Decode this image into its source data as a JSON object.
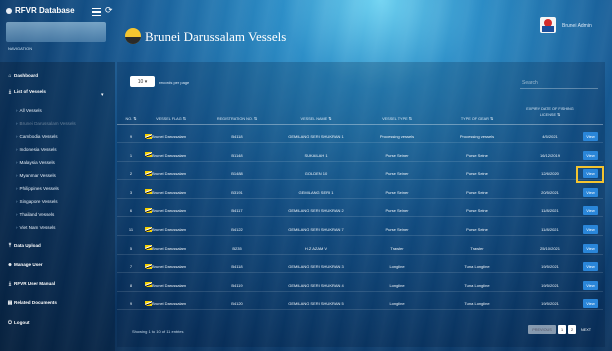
{
  "app": {
    "brand": "RFVR Database",
    "page_title": "Brunei Darussalam Vessels",
    "username": "Brunei Admin"
  },
  "sidebar": {
    "section_label": "NAVIGATION",
    "items": [
      {
        "label": "Dashboard",
        "icon": "home-icon"
      },
      {
        "label": "List of Vessels",
        "icon": "download-icon"
      },
      {
        "label": "All Vessels"
      },
      {
        "label": "Brunei Darussalam Vessels"
      },
      {
        "label": "Cambodia Vessels"
      },
      {
        "label": "Indonesia Vessels"
      },
      {
        "label": "Malaysia Vessels"
      },
      {
        "label": "Myanmar Vessels"
      },
      {
        "label": "Philippines Vessels"
      },
      {
        "label": "Singapore Vessels"
      },
      {
        "label": "Thailand Vessels"
      },
      {
        "label": "Viet Nam Vessels"
      },
      {
        "label": "Data Upload",
        "icon": "upload-icon"
      },
      {
        "label": "Manage User",
        "icon": "users-icon"
      },
      {
        "label": "RFVR User Manual",
        "icon": "download-icon"
      },
      {
        "label": "Related Documents",
        "icon": "document-icon"
      },
      {
        "label": "Logout",
        "icon": "power-icon"
      }
    ]
  },
  "table_controls": {
    "length_value": "10",
    "length_label": "records per page",
    "search_placeholder": "Search"
  },
  "table": {
    "headers": [
      "NO.",
      "VESSEL FLAG",
      "REGISTRATION NO.",
      "VESSEL NAME",
      "VESSEL TYPE",
      "TYPE OF GEAR",
      "EXPIRY DATE OF FISHING LICENSE",
      ""
    ],
    "rows": [
      [
        "9",
        "Brunei Darussalam",
        "B4118",
        "GEMILANG SERI SHUKRAN 1",
        "Processing vessels",
        "Processing vessels",
        "4/5/2021",
        "View"
      ],
      [
        "1",
        "Brunei Darussalam",
        "B1148",
        "SUKAILAH 1",
        "Purse Seiner",
        "Purse Seine",
        "16/12/2019",
        "View"
      ],
      [
        "2",
        "Brunei Darussalam",
        "B1488",
        "GOLDEN 10",
        "Purse Seiner",
        "Purse Seine",
        "12/6/2020",
        "View"
      ],
      [
        "3",
        "Brunei Darussalam",
        "B3191",
        "GEMILANG SERI 1",
        "Purse Seiner",
        "Purse Seine",
        "20/5/2021",
        "View"
      ],
      [
        "6",
        "Brunei Darussalam",
        "B4117",
        "GEMILANG SERI SHUKRAN 2",
        "Purse Seiner",
        "Purse Seine",
        "11/8/2021",
        "View"
      ],
      [
        "11",
        "Brunei Darussalam",
        "B4122",
        "GEMILANG SERI SHUKRAN 7",
        "Purse Seiner",
        "Purse Seine",
        "11/8/2021",
        "View"
      ],
      [
        "5",
        "Brunei Darussalam",
        "B235",
        "H.Z AZAM V",
        "Trawler",
        "Trawler",
        "25/10/2021",
        "View"
      ],
      [
        "7",
        "Brunei Darussalam",
        "B4118",
        "GEMILANG SERI SHUKRAN 3",
        "Longline",
        "Tuna Longline",
        "19/5/2021",
        "View"
      ],
      [
        "8",
        "Brunei Darussalam",
        "B4119",
        "GEMILANG SERI SHUKRAN 4",
        "Longline",
        "Tuna Longline",
        "19/5/2021",
        "View"
      ],
      [
        "9",
        "Brunei Darussalam",
        "B4120",
        "GEMILANG SERI SHUKRAN 5",
        "Longline",
        "Tuna Longline",
        "19/5/2021",
        "View"
      ]
    ]
  },
  "footer": {
    "info": "Showing 1 to 10 of 11 entries",
    "prev": "PREVIOUS",
    "page1": "1",
    "page2": "2",
    "next": "NEXT"
  },
  "colors": {
    "accent": "#2a86d9",
    "highlight": "#f4c430"
  }
}
